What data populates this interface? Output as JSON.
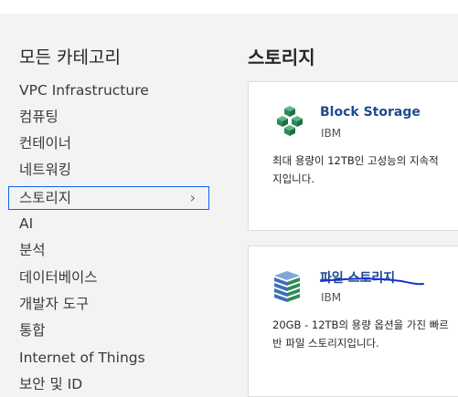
{
  "sidebar": {
    "heading": "모든 카테고리",
    "items": [
      {
        "label": "VPC Infrastructure"
      },
      {
        "label": "컴퓨팅"
      },
      {
        "label": "컨테이너"
      },
      {
        "label": "네트워킹"
      },
      {
        "label": "스토리지",
        "selected": true
      },
      {
        "label": "AI"
      },
      {
        "label": "분석"
      },
      {
        "label": "데이터베이스"
      },
      {
        "label": "개발자 도구"
      },
      {
        "label": "통합"
      },
      {
        "label": "Internet of Things"
      },
      {
        "label": "보안 및 ID"
      }
    ],
    "chevron": "chevron-right-icon"
  },
  "main": {
    "title": "스토리지",
    "cards": [
      {
        "name": "Block Storage",
        "vendor": "IBM",
        "desc_line1": "최대 용량이 12TB인 고성능의 지속적",
        "desc_line2": "지입니다.",
        "icon": "block-storage-icon"
      },
      {
        "name": "파일 스토리지",
        "vendor": "IBM",
        "desc_line1": "20GB - 12TB의 용량 옵션을 가진 빠르",
        "desc_line2": "반 파일 스토리지입니다.",
        "icon": "file-storage-icon"
      }
    ]
  },
  "colors": {
    "accent": "#0f62fe",
    "link": "#1f4b8f",
    "icon_green": "#2e8b57",
    "icon_blue": "#3d6fb6",
    "annotation": "#1a2fd6"
  }
}
